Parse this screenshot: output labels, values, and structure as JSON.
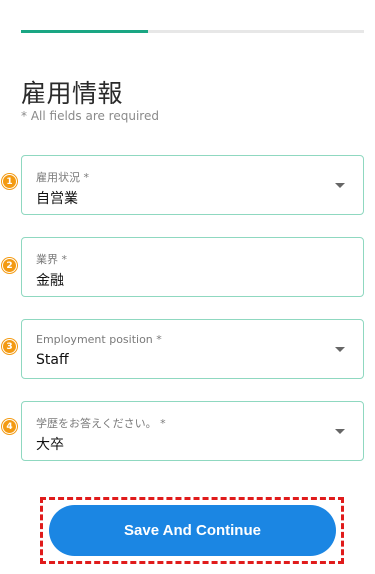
{
  "progress": {
    "fraction": 0.37
  },
  "header": {
    "title": "雇用情報",
    "subtitle": "* All fields are required"
  },
  "fields": [
    {
      "step": "1",
      "label": "雇用状況 *",
      "value": "自営業"
    },
    {
      "step": "2",
      "label": "業界 *",
      "value": "金融"
    },
    {
      "step": "3",
      "label": "Employment position *",
      "value": "Staff"
    },
    {
      "step": "4",
      "label": "学歴をお答えください。 *",
      "value": "大卒"
    }
  ],
  "actions": {
    "save_label": "Save And Continue"
  },
  "colors": {
    "accent": "#1aa683",
    "field_border": "#8fd8c0",
    "button": "#1b86e3",
    "badge": "#f39a12",
    "highlight": "#e01b1b"
  }
}
